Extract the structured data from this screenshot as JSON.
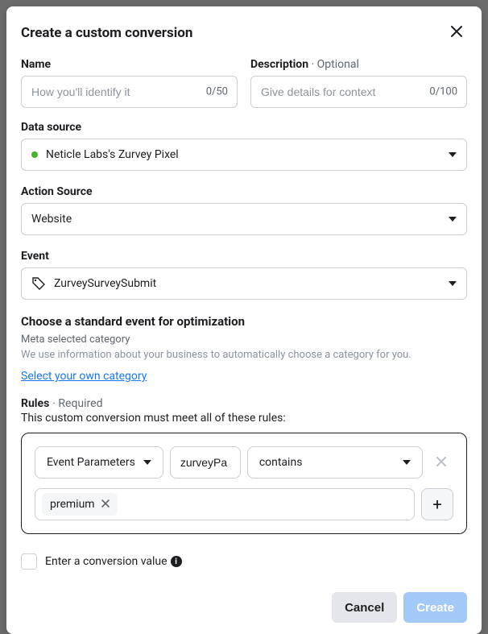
{
  "modal": {
    "title": "Create a custom conversion"
  },
  "name": {
    "label": "Name",
    "placeholder": "How you'll identify it",
    "count": "0/50"
  },
  "description": {
    "label": "Description",
    "optional": " · Optional",
    "placeholder": "Give details for context",
    "count": "0/100"
  },
  "dataSource": {
    "label": "Data source",
    "value": "Neticle Labs's Zurvey Pixel"
  },
  "actionSource": {
    "label": "Action Source",
    "value": "Website"
  },
  "event": {
    "label": "Event",
    "value": "ZurveySurveySubmit"
  },
  "standardEvent": {
    "title": "Choose a standard event for optimization",
    "sub": "Meta selected category",
    "desc": "We use information about your business to automatically choose a category for you.",
    "link": "Select your own category"
  },
  "rules": {
    "label": "Rules",
    "required": " · Required",
    "desc": "This custom conversion must meet all of these rules:",
    "paramType": "Event Parameters",
    "paramKey": "zurveyPa",
    "condition": "contains",
    "token": "premium"
  },
  "conversionValue": {
    "label": "Enter a conversion value"
  },
  "buttons": {
    "cancel": "Cancel",
    "create": "Create"
  }
}
